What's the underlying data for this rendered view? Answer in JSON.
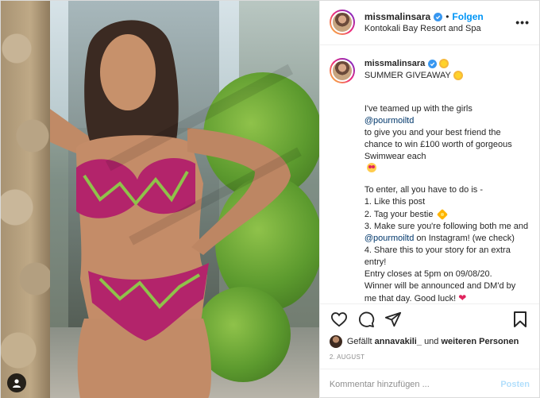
{
  "header": {
    "username": "missmalinsara",
    "dot": "•",
    "follow_label": "Folgen",
    "location": "Kontokali Bay Resort and Spa",
    "more_label": "•••"
  },
  "caption": {
    "username": "missmalinsara",
    "title_text": "SUMMER GIVEAWAY",
    "line_intro_1": "I've teamed up with the girls",
    "mention_1": "@pourmoiltd",
    "line_intro_2": "to give you and your best friend the chance to win £100 worth of gorgeous Swimwear each",
    "line_enter": "To enter, all you have to do is -",
    "step_1": "1. Like this post",
    "step_2": "2. Tag your bestie",
    "step_3_a": "3. Make sure you're following both me and",
    "mention_2": "@pourmoiltd",
    "step_3_b": "on Instagram! (we check)",
    "step_4": "4. Share this to your story for an extra entry!",
    "closing_1": "Entry closes at 5pm on 09/08/20.",
    "closing_2": "Winner will be announced and DM'd by me that day. Good luck!"
  },
  "likes": {
    "prefix": "Gefällt",
    "user": "annavakili_",
    "middle": "und",
    "others": "weiteren Personen"
  },
  "date": "2. AUGUST",
  "comment": {
    "placeholder": "Kommentar hinzufügen ...",
    "post_label": "Posten"
  },
  "icons": {
    "like": "heart-icon",
    "comment": "comment-icon",
    "share": "share-icon",
    "save": "bookmark-icon",
    "tag": "user-tag-icon"
  },
  "colors": {
    "accent": "#0095f6",
    "verified": "#3897f0",
    "mention": "#00376b",
    "muted": "#8e8e8e",
    "post_disabled": "#b2dffc"
  }
}
